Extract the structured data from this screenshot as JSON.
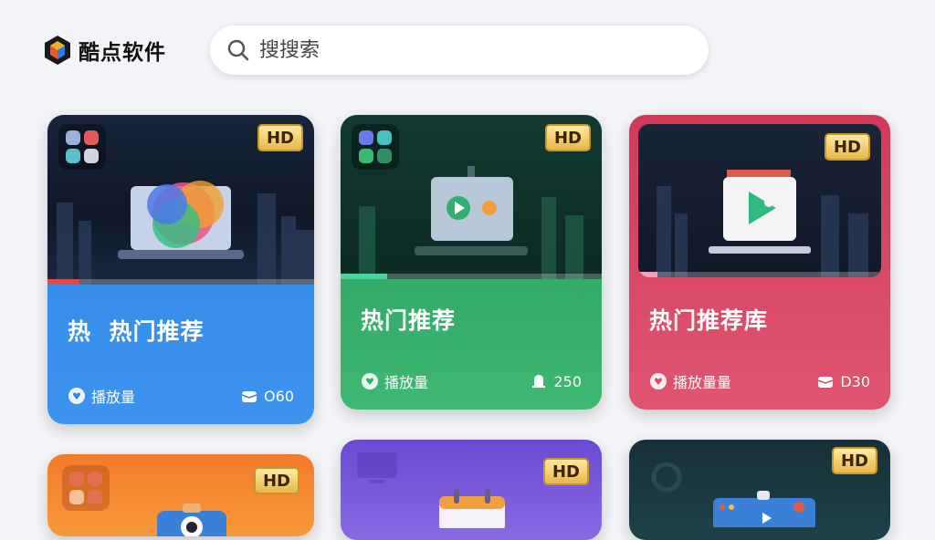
{
  "app": {
    "name": "酷点软件"
  },
  "search": {
    "placeholder": "搜搜索"
  },
  "colors": {
    "blue": "#2f86e6",
    "green": "#2fae66",
    "red": "#dc4a64",
    "orange": "#f08a2a",
    "purple": "#7b5fd9",
    "dark": "#1d3a44"
  },
  "cards": [
    {
      "badge": "HD",
      "title_prefix": "热",
      "title": "热门推荐",
      "plays_label": "播放量",
      "count": "O60",
      "color": "blue",
      "icon": "colorful-blob-icon"
    },
    {
      "badge": "HD",
      "title": "热门推荐",
      "plays_label": "播放量",
      "count": "250",
      "color": "green",
      "icon": "play-icon"
    },
    {
      "badge": "HD",
      "title": "热门推荐库",
      "plays_label": "播放量量",
      "count": "D30",
      "color": "red",
      "icon": "video-play-icon"
    },
    {
      "badge": "HD",
      "color": "orange",
      "icon": "camera-icon"
    },
    {
      "badge": "HD",
      "color": "purple",
      "icon": "calendar-icon"
    },
    {
      "badge": "HD",
      "color": "dark",
      "icon": "browser-icon"
    }
  ]
}
